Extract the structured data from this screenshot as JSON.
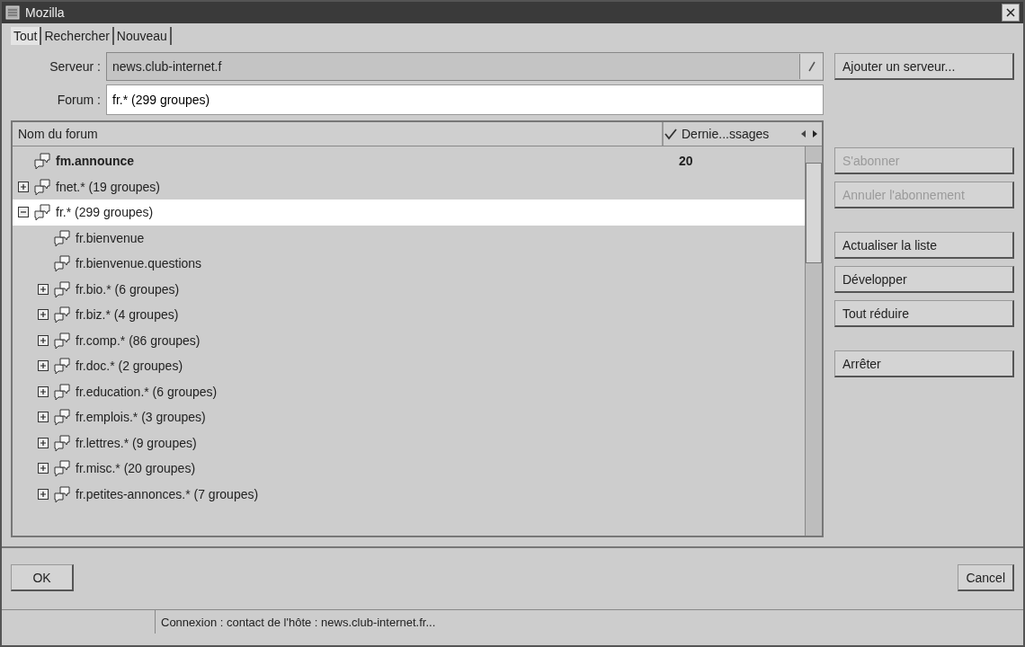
{
  "window": {
    "title": "Mozilla"
  },
  "tabs": [
    {
      "label": "Tout",
      "selected": true
    },
    {
      "label": "Rechercher",
      "selected": false
    },
    {
      "label": "Nouveau",
      "selected": false
    }
  ],
  "server": {
    "label": "Serveur :",
    "value": "news.club-internet.f"
  },
  "forum": {
    "label": "Forum :",
    "value": "fr.* (299 groupes)"
  },
  "add_server_button": "Ajouter un serveur...",
  "table": {
    "columns": [
      {
        "label": "Nom du forum"
      },
      {
        "label": "Dernie...ssages",
        "checked": true
      }
    ],
    "rows": [
      {
        "kind": "forum",
        "name": "fm.announce",
        "new": true,
        "count": "20",
        "selected": false
      },
      {
        "kind": "group",
        "name": "fnet.* (19 groupes)",
        "new": false,
        "expanded": false,
        "selected": false
      },
      {
        "kind": "group",
        "name": "fr.* (299 groupes)",
        "new": false,
        "expanded": true,
        "selected": true,
        "children": [
          {
            "kind": "forum",
            "name": "fr.bienvenue",
            "new": false,
            "selected": false
          },
          {
            "kind": "forum",
            "name": "fr.bienvenue.questions",
            "new": false,
            "selected": false
          },
          {
            "kind": "group",
            "name": "fr.bio.* (6 groupes)",
            "new": false,
            "expanded": false,
            "selected": false
          },
          {
            "kind": "group",
            "name": "fr.biz.* (4 groupes)",
            "new": false,
            "expanded": false,
            "selected": false
          },
          {
            "kind": "group",
            "name": "fr.comp.* (86 groupes)",
            "new": false,
            "expanded": false,
            "selected": false
          },
          {
            "kind": "group",
            "name": "fr.doc.* (2 groupes)",
            "new": false,
            "expanded": false,
            "selected": false
          },
          {
            "kind": "group",
            "name": "fr.education.* (6 groupes)",
            "new": false,
            "expanded": false,
            "selected": false
          },
          {
            "kind": "group",
            "name": "fr.emplois.* (3 groupes)",
            "new": false,
            "expanded": false,
            "selected": false
          },
          {
            "kind": "group",
            "name": "fr.lettres.* (9 groupes)",
            "new": false,
            "expanded": false,
            "selected": false
          },
          {
            "kind": "group",
            "name": "fr.misc.* (20 groupes)",
            "new": false,
            "expanded": false,
            "selected": false
          },
          {
            "kind": "group",
            "name": "fr.petites-annonces.* (7 groupes)",
            "new": false,
            "expanded": false,
            "selected": false
          }
        ]
      }
    ]
  },
  "side_button_groups": [
    [
      {
        "label": "S'abonner",
        "disabled": true
      },
      {
        "label": "Annuler l'abonnement",
        "disabled": true
      }
    ],
    [
      {
        "label": "Actualiser la liste",
        "disabled": false
      },
      {
        "label": "Développer",
        "disabled": false
      },
      {
        "label": "Tout réduire",
        "disabled": false
      }
    ],
    [
      {
        "label": "Arrêter",
        "disabled": false
      }
    ]
  ],
  "ok_button": "OK",
  "cancel_button": "Cancel",
  "status_bar": "Connexion : contact de l'hôte : news.club-internet.fr..."
}
